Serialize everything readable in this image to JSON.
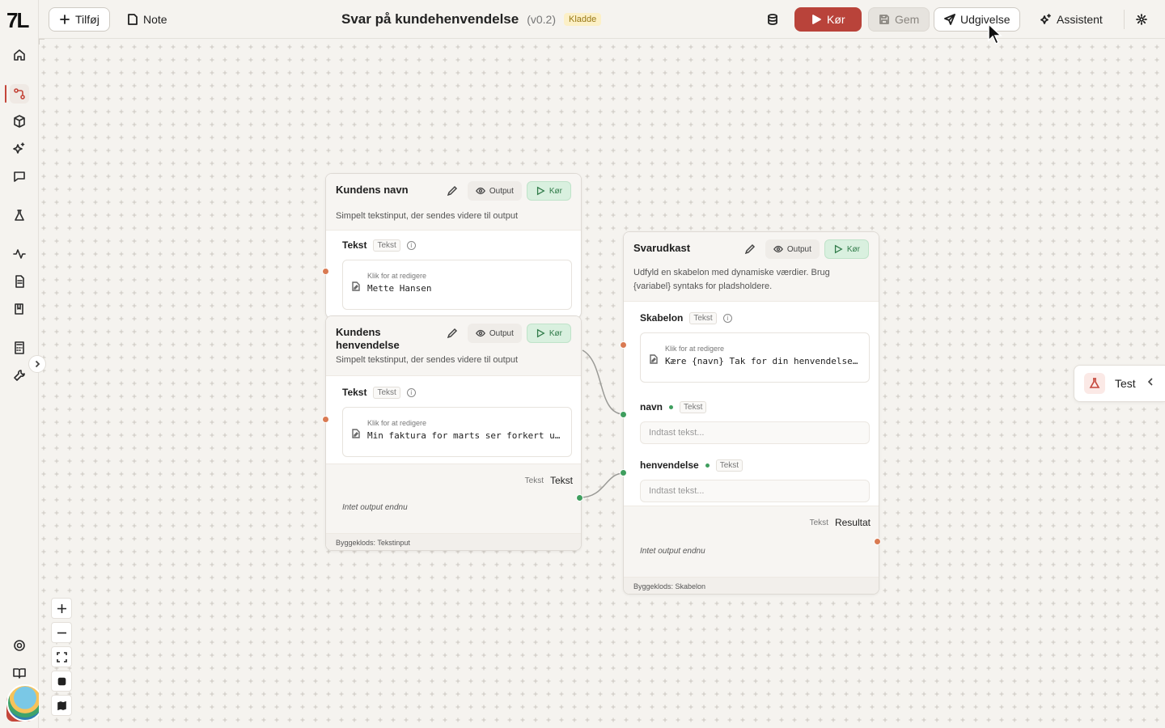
{
  "app": {
    "logo": "7L"
  },
  "toolbar": {
    "add_label": "Tilføj",
    "note_label": "Note",
    "title": "Svar på kundehenvendelse",
    "version": "(v0.2)",
    "status_badge": "Kladde",
    "run_label": "Kør",
    "save_label": "Gem",
    "publish_label": "Udgivelse",
    "assistant_label": "Assistent"
  },
  "nodes": {
    "name_node": {
      "title": "Kundens navn",
      "description": "Simpelt tekstinput, der sendes videre til output",
      "output_chip": "Output",
      "run_chip": "Kør",
      "field_label": "Tekst",
      "field_type": "Tekst",
      "edit_hint": "Klik for at redigere",
      "value": "Mette Hansen"
    },
    "inquiry_node": {
      "title": "Kundens henvendelse",
      "description": "Simpelt tekstinput, der sendes videre til output",
      "output_chip": "Output",
      "run_chip": "Kør",
      "field_label": "Tekst",
      "field_type": "Tekst",
      "edit_hint": "Klik for at redigere",
      "value": "Min faktura for marts ser forkert u…",
      "out_type": "Tekst",
      "out_name": "Tekst",
      "out_empty": "Intet output endnu",
      "footer": "Byggeklods: Tekstinput"
    },
    "draft_node": {
      "title": "Svarudkast",
      "description": "Udfyld en skabelon med dynamiske værdier. Brug {variabel} syntaks for pladsholdere.",
      "output_chip": "Output",
      "run_chip": "Kør",
      "template_label": "Skabelon",
      "template_type": "Tekst",
      "edit_hint": "Klik for at redigere",
      "template_value": "Kære {navn} Tak for din henvendelse…",
      "var1_label": "navn",
      "var1_type": "Tekst",
      "var1_placeholder": "Indtast tekst...",
      "var2_label": "henvendelse",
      "var2_type": "Tekst",
      "var2_placeholder": "Indtast tekst...",
      "out_type": "Tekst",
      "out_name": "Resultat",
      "out_empty": "Intet output endnu",
      "footer": "Byggeklods: Skabelon"
    }
  },
  "test_panel": {
    "label": "Test"
  },
  "colors": {
    "accent": "#c4463a",
    "run_button": "#b9433a",
    "run_chip_bg": "#d9f0df",
    "port_input": "#d97a52",
    "port_connected": "#3f9e5e",
    "draft_badge_bg": "#fcf0c7"
  },
  "icons": {
    "sidebar": [
      "home-icon",
      "workflow-icon",
      "cube-icon",
      "sparkles-icon",
      "chat-icon",
      "flask-icon",
      "activity-icon",
      "document-icon",
      "book-icon",
      "calculator-icon",
      "wrench-icon",
      "help-icon",
      "docs-icon"
    ]
  }
}
